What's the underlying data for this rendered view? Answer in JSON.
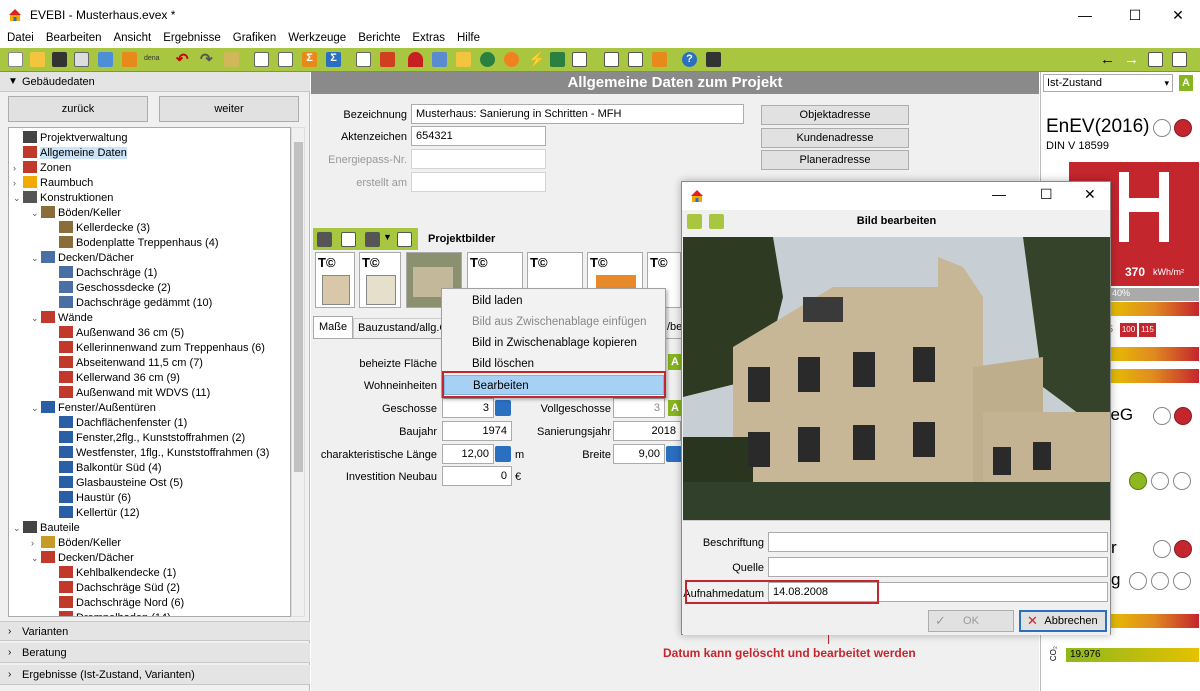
{
  "window": {
    "title": "EVEBI - Musterhaus.evex *",
    "minimize": "—",
    "maximize": "☐",
    "close": "✕"
  },
  "menu": [
    "Datei",
    "Bearbeiten",
    "Ansicht",
    "Ergebnisse",
    "Grafiken",
    "Werkzeuge",
    "Berichte",
    "Extras",
    "Hilfe"
  ],
  "toolbar": {
    "dena_label": "dena",
    "nav_back": "←",
    "nav_forward": "→"
  },
  "left": {
    "section_title": "Gebäudedaten",
    "back_button": "zurück",
    "forward_button": "weiter",
    "tree": [
      {
        "label": "Projektverwaltung",
        "level": 1,
        "icon": "stopwatch-icon",
        "toggle": ""
      },
      {
        "label": "Allgemeine Daten",
        "level": 1,
        "icon": "house-icon",
        "toggle": "",
        "selected": true
      },
      {
        "label": "Zonen",
        "level": 1,
        "icon": "zones-icon",
        "toggle": "›"
      },
      {
        "label": "Raumbuch",
        "level": 1,
        "icon": "roombook-icon",
        "toggle": "›"
      },
      {
        "label": "Konstruktionen",
        "level": 1,
        "icon": "construction-icon",
        "toggle": "⌄"
      },
      {
        "label": "Böden/Keller",
        "level": 2,
        "icon": "floor-icon",
        "toggle": "⌄"
      },
      {
        "label": "Kellerdecke (3)",
        "level": 3,
        "icon": "floor-layer-icon",
        "toggle": ""
      },
      {
        "label": "Bodenplatte Treppenhaus (4)",
        "level": 3,
        "icon": "floor-layer-icon",
        "toggle": ""
      },
      {
        "label": "Decken/Dächer",
        "level": 2,
        "icon": "ceiling-icon",
        "toggle": "⌄"
      },
      {
        "label": "Dachschräge (1)",
        "level": 3,
        "icon": "ceiling-layer-icon",
        "toggle": ""
      },
      {
        "label": "Geschossdecke (2)",
        "level": 3,
        "icon": "ceiling-layer-icon",
        "toggle": ""
      },
      {
        "label": "Dachschräge gedämmt (10)",
        "level": 3,
        "icon": "ceiling-layer-icon",
        "toggle": ""
      },
      {
        "label": "Wände",
        "level": 2,
        "icon": "wall-icon",
        "toggle": "⌄"
      },
      {
        "label": "Außenwand 36 cm (5)",
        "level": 3,
        "icon": "wall-layer-icon",
        "toggle": ""
      },
      {
        "label": "Kellerinnenwand zum Treppenhaus (6)",
        "level": 3,
        "icon": "wall-layer-icon",
        "toggle": ""
      },
      {
        "label": "Abseitenwand 11,5 cm (7)",
        "level": 3,
        "icon": "wall-layer-icon",
        "toggle": ""
      },
      {
        "label": "Kellerwand 36 cm (9)",
        "level": 3,
        "icon": "wall-layer-icon",
        "toggle": ""
      },
      {
        "label": "Außenwand mit WDVS (11)",
        "level": 3,
        "icon": "wall-layer-icon",
        "toggle": ""
      },
      {
        "label": "Fenster/Außentüren",
        "level": 2,
        "icon": "window-icon",
        "toggle": "⌄"
      },
      {
        "label": "Dachflächenfenster (1)",
        "level": 3,
        "icon": "window-item-icon",
        "toggle": ""
      },
      {
        "label": "Fenster,2flg., Kunststoffrahmen (2)",
        "level": 3,
        "icon": "window-item-icon",
        "toggle": ""
      },
      {
        "label": "Westfenster, 1flg., Kunststoffrahmen (3)",
        "level": 3,
        "icon": "window-item-icon",
        "toggle": ""
      },
      {
        "label": "Balkontür Süd (4)",
        "level": 3,
        "icon": "window-item-icon",
        "toggle": ""
      },
      {
        "label": "Glasbausteine Ost (5)",
        "level": 3,
        "icon": "window-item-icon",
        "toggle": ""
      },
      {
        "label": "Haustür (6)",
        "level": 3,
        "icon": "window-item-icon",
        "toggle": ""
      },
      {
        "label": "Kellertür (12)",
        "level": 3,
        "icon": "window-item-icon",
        "toggle": ""
      },
      {
        "label": "Bauteile",
        "level": 1,
        "icon": "building-parts-icon",
        "toggle": "⌄"
      },
      {
        "label": "Böden/Keller",
        "level": 2,
        "icon": "floor-part-icon",
        "toggle": "›"
      },
      {
        "label": "Decken/Dächer",
        "level": 2,
        "icon": "roof-part-icon",
        "toggle": "⌄"
      },
      {
        "label": "Kehlbalkendecke (1)",
        "level": 3,
        "icon": "roof-item-icon",
        "toggle": ""
      },
      {
        "label": "Dachschräge Süd (2)",
        "level": 3,
        "icon": "roof-item-icon",
        "toggle": ""
      },
      {
        "label": "Dachschräge Nord (6)",
        "level": 3,
        "icon": "roof-item-icon",
        "toggle": ""
      },
      {
        "label": "Drempelboden (14)",
        "level": 3,
        "icon": "roof-item-icon",
        "toggle": ""
      }
    ],
    "bottom_sections": [
      "Varianten",
      "Beratung",
      "Ergebnisse (Ist-Zustand, Varianten)"
    ]
  },
  "main": {
    "header": "Allgemeine Daten zum Projekt",
    "bezeichnung_label": "Bezeichnung",
    "bezeichnung_value": "Musterhaus: Sanierung in Schritten - MFH",
    "aktenzeichen_label": "Aktenzeichen",
    "aktenzeichen_value": "654321",
    "energiepass_label": "Energiepass-Nr.",
    "erstellt_label": "erstellt am",
    "objektadresse_button": "Objektadresse",
    "kundenadresse_button": "Kundenadresse",
    "planeradresse_button": "Planeradresse",
    "projektbilder_label": "Projektbilder",
    "tabs": [
      "Maße",
      "Bauzustand/allg.G",
      "/be"
    ],
    "beheizte_flaeche_label": "beheizte Fläche",
    "wohneinheiten_label": "Wohneinheiten",
    "geschosse_label": "Geschosse",
    "geschosse_value": "3",
    "vollgeschosse_label": "Vollgeschosse",
    "vollgeschosse_value": "3",
    "baujahr_label": "Baujahr",
    "baujahr_value": "1974",
    "sanierungsjahr_label": "Sanierungsjahr",
    "sanierungsjahr_value": "2018",
    "char_laenge_label": "charakteristische Länge",
    "char_laenge_value": "12,00",
    "char_laenge_unit": "m",
    "breite_label": "Breite",
    "breite_value": "9,00",
    "investition_label": "Investition Neubau",
    "investition_value": "0",
    "investition_unit": "€"
  },
  "context_menu": {
    "items": [
      {
        "label": "Bild laden",
        "disabled": false
      },
      {
        "label": "Bild aus Zwischenablage einfügen",
        "disabled": true
      },
      {
        "label": "Bild in Zwischenablage kopieren",
        "disabled": false
      },
      {
        "label": "Bild löschen",
        "disabled": false
      },
      {
        "label": "Bearbeiten",
        "disabled": false,
        "highlighted": true
      }
    ]
  },
  "dialog": {
    "title": "Bild bearbeiten",
    "beschriftung_label": "Beschriftung",
    "quelle_label": "Quelle",
    "aufnahmedatum_label": "Aufnahmedatum",
    "aufnahmedatum_value": "14.08.2008",
    "ok_button": "OK",
    "cancel_button": "Abbrechen"
  },
  "annotation": "Datum kann gelöscht und bearbeitet werden",
  "right": {
    "state_select": "Ist-Zustand",
    "enev_label": "EnEV(2016)",
    "din_label": "DIN V 18599",
    "energy_value": "370",
    "energy_unit": "kWh/m²",
    "percent_label": "40%",
    "bar_values": [
      "100",
      "115"
    ],
    "bar_prefix": "5",
    "eeg_label": "neG",
    "r_label": "r",
    "g_label": "g",
    "co2_value": "19.976",
    "co2_label": "CO₂"
  },
  "colors": {
    "toolbar_green": "#a9c640",
    "header_gray": "#8a8a8a",
    "accent_red": "#c4262e",
    "status_green": "#8db81f"
  }
}
